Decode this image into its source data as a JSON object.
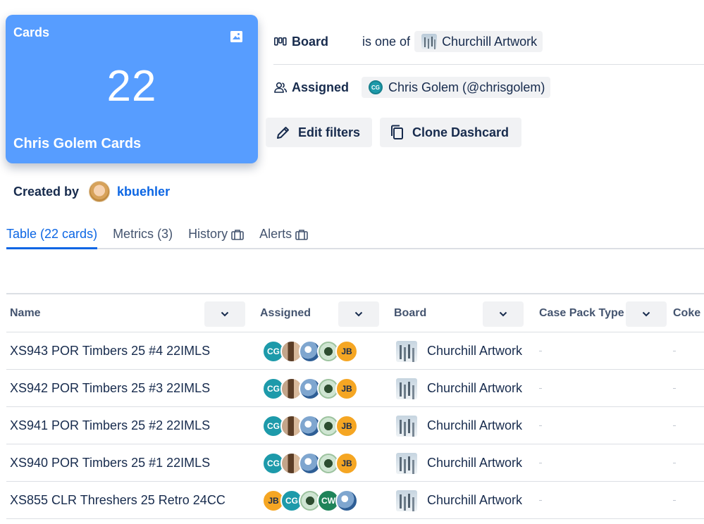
{
  "card": {
    "title": "Cards",
    "count": "22",
    "name": "Chris Golem Cards",
    "accent": "#579dff"
  },
  "filters": {
    "board": {
      "label": "Board",
      "operator": "is one of",
      "value": "Churchill Artwork"
    },
    "assigned": {
      "label": "Assigned",
      "avatar": "CG",
      "value": "Chris Golem (@chrisgolem)"
    }
  },
  "actions": {
    "edit_filters": "Edit filters",
    "clone_dashcard": "Clone Dashcard"
  },
  "created_by": {
    "label": "Created by",
    "user": "kbuehler"
  },
  "tabs": [
    {
      "label": "Table (22 cards)",
      "active": true,
      "locked": false
    },
    {
      "label": "Metrics (3)",
      "active": false,
      "locked": false
    },
    {
      "label": "History",
      "active": false,
      "locked": true
    },
    {
      "label": "Alerts",
      "active": false,
      "locked": true
    }
  ],
  "table": {
    "columns": [
      "Name",
      "Assigned",
      "Board",
      "Case Pack Type",
      "Coke"
    ],
    "rows": [
      {
        "name": "XS943 POR Timbers 25 #4 22IMLS",
        "board": "Churchill Artwork",
        "assignees": [
          "CG",
          "photo",
          "photo",
          "photo",
          "JB"
        ]
      },
      {
        "name": "XS942 POR Timbers 25 #3 22IMLS",
        "board": "Churchill Artwork",
        "assignees": [
          "CG",
          "photo",
          "photo",
          "photo",
          "JB"
        ]
      },
      {
        "name": "XS941 POR Timbers 25 #2 22IMLS",
        "board": "Churchill Artwork",
        "assignees": [
          "CG",
          "photo",
          "photo",
          "photo",
          "JB"
        ]
      },
      {
        "name": "XS940 POR Timbers 25 #1 22IMLS",
        "board": "Churchill Artwork",
        "assignees": [
          "CG",
          "photo",
          "photo",
          "photo",
          "JB"
        ]
      },
      {
        "name": "XS855 CLR Threshers 25 Retro 24CC",
        "board": "Churchill Artwork",
        "assignees": [
          "JB",
          "CG",
          "photo",
          "CW",
          "photo"
        ]
      }
    ]
  },
  "colors": {
    "link": "#0c66e4",
    "text": "#172b4d",
    "subtle": "#44546f",
    "button_bg": "#f1f2f4"
  }
}
